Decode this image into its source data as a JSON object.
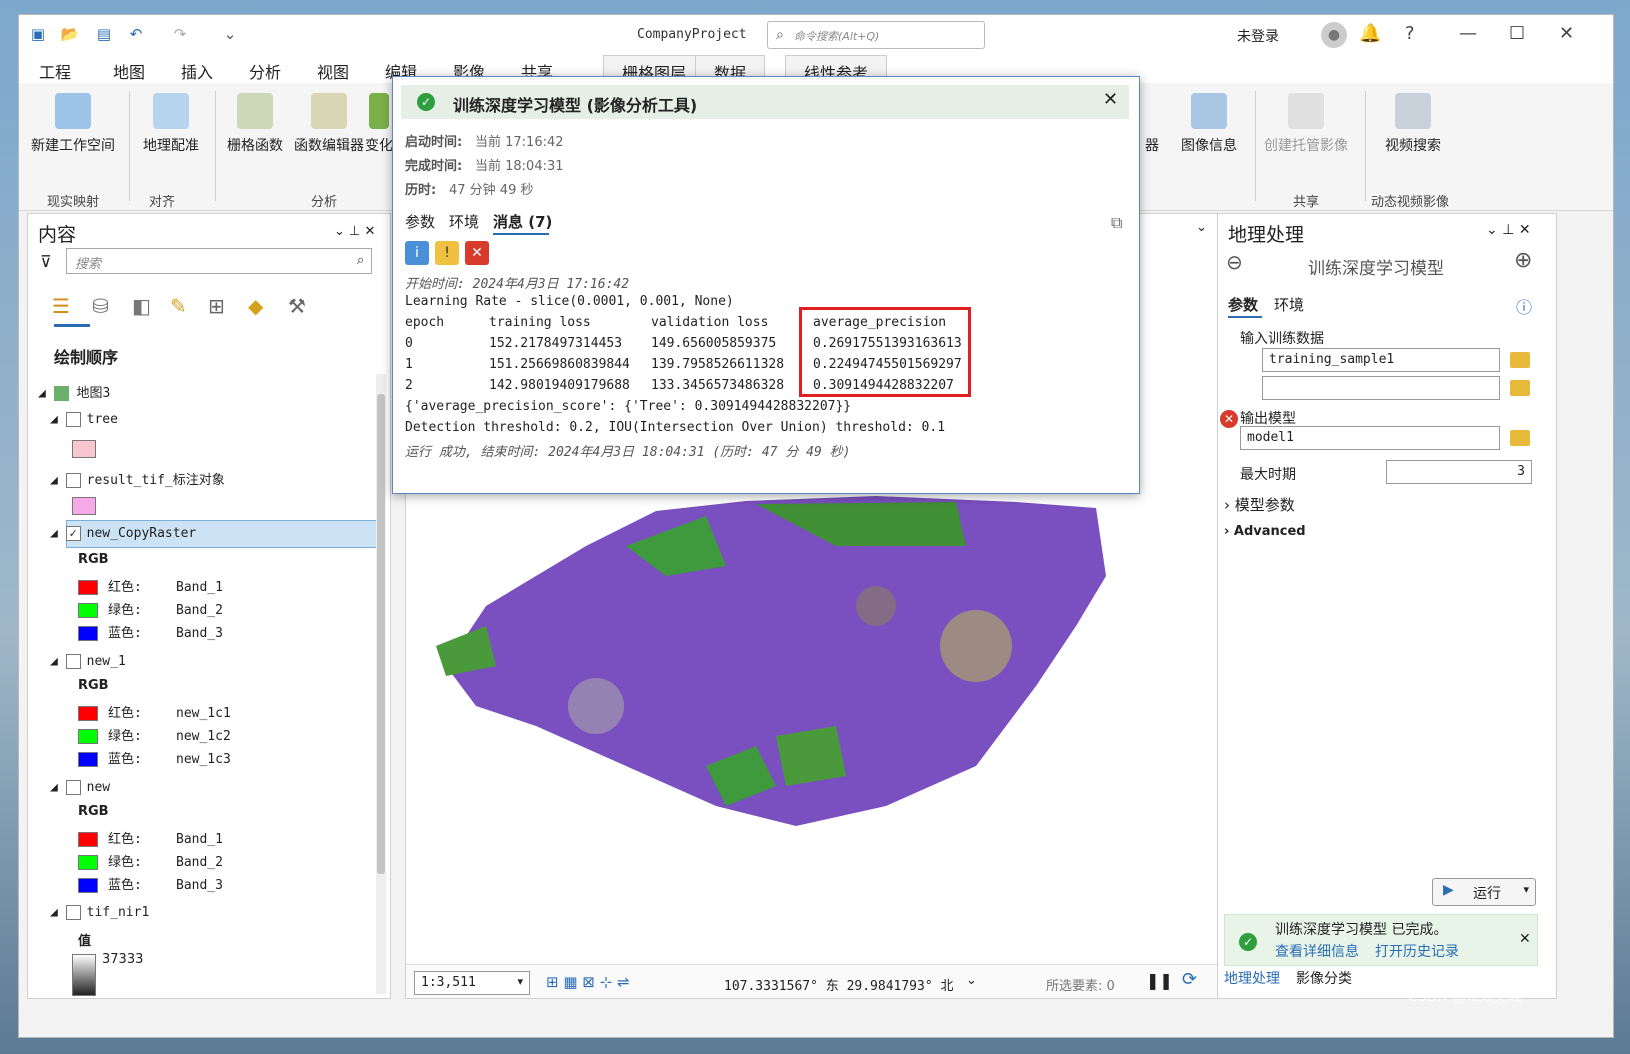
{
  "title_bar": {
    "app_name": "CompanyProject",
    "search_placeholder": "命令搜索(Alt+Q)",
    "user": "未登录",
    "help": "?"
  },
  "menu": [
    "工程",
    "地图",
    "插入",
    "分析",
    "视图",
    "编辑",
    "影像",
    "共享"
  ],
  "context_tabs": [
    "栅格图层",
    "数据",
    "线性参考"
  ],
  "ribbon": {
    "buttons": [
      "新建工作空间",
      "地理配准",
      "栅格函数",
      "函数编辑器",
      "变化",
      "器",
      "图像信息",
      "创建托管影像",
      "视频搜索"
    ],
    "groups": [
      "现实映射",
      "对齐",
      "分析",
      "共享",
      "动态视频影像"
    ]
  },
  "contents": {
    "title": "内容",
    "search_placeholder": "搜索",
    "section": "绘制顺序",
    "map_name": "地图3",
    "layers": [
      {
        "name": "tree",
        "checked": false,
        "swatch": "#f7c6cf"
      },
      {
        "name": "result_tif_标注对象",
        "checked": false,
        "swatch": "#f5a9e8"
      },
      {
        "name": "new_CopyRaster",
        "checked": true,
        "rgb_label": "RGB",
        "bands": [
          {
            "k": "红色:",
            "v": "Band_1"
          },
          {
            "k": "绿色:",
            "v": "Band_2"
          },
          {
            "k": "蓝色:",
            "v": "Band_3"
          }
        ]
      },
      {
        "name": "new_1",
        "checked": false,
        "rgb_label": "RGB",
        "bands": [
          {
            "k": "红色:",
            "v": "new_1c1"
          },
          {
            "k": "绿色:",
            "v": "new_1c2"
          },
          {
            "k": "蓝色:",
            "v": "new_1c3"
          }
        ]
      },
      {
        "name": "new",
        "checked": false,
        "rgb_label": "RGB",
        "bands": [
          {
            "k": "红色:",
            "v": "Band_1"
          },
          {
            "k": "绿色:",
            "v": "Band_2"
          },
          {
            "k": "蓝色:",
            "v": "Band_3"
          }
        ]
      },
      {
        "name": "tif_nir1",
        "checked": false,
        "value_label": "值",
        "value": "37333"
      }
    ]
  },
  "map_status": {
    "scale": "1:3,511",
    "coords": "107.3331567° 东 29.9841793° 北",
    "selected": "所选要素: 0"
  },
  "dialog": {
    "title": "训练深度学习模型 (影像分析工具)",
    "start_label": "启动时间:",
    "start_value": "当前 17:16:42",
    "end_label": "完成时间:",
    "end_value": "当前 18:04:31",
    "elapsed_label": "历时:",
    "elapsed_value": "47 分钟 49 秒",
    "tabs": [
      "参数",
      "环境",
      "消息 (7)"
    ],
    "messages": {
      "line1": "开始时间: 2024年4月3日 17:16:42",
      "line2": "Learning Rate - slice(0.0001, 0.001, None)",
      "headers": [
        "epoch",
        "training loss",
        "validation loss",
        "average_precision"
      ],
      "rows": [
        [
          "0",
          "152.2178497314453",
          "149.656005859375",
          "0.26917551393163613"
        ],
        [
          "1",
          "151.25669860839844",
          "139.7958526611328",
          "0.22494745501569297"
        ],
        [
          "2",
          "142.98019409179688",
          "133.3456573486328",
          "0.3091494428832207"
        ]
      ],
      "line3": "{'average_precision_score': {'Tree': 0.3091494428832207}}",
      "line4": "Detection threshold: 0.2, IOU(Intersection Over Union) threshold: 0.1",
      "line5": "运行 成功, 结束时间: 2024年4月3日 18:04:31 (历时: 47 分 49 秒)"
    }
  },
  "geoprocessing": {
    "title": "地理处理",
    "tool": "训练深度学习模型",
    "tabs": [
      "参数",
      "环境"
    ],
    "input_label": "输入训练数据",
    "input_value": "training_sample1",
    "output_label": "输出模型",
    "output_value": "model1",
    "epochs_label": "最大时期",
    "epochs_value": "3",
    "model_params": "模型参数",
    "advanced": "Advanced",
    "run": "运行",
    "done_text": "训练深度学习模型 已完成。",
    "view_details": "查看详细信息",
    "open_history": "打开历史记录",
    "bottom_tabs": [
      "地理处理",
      "影像分类"
    ]
  },
  "watermark": "CSDN @斌斌无理"
}
